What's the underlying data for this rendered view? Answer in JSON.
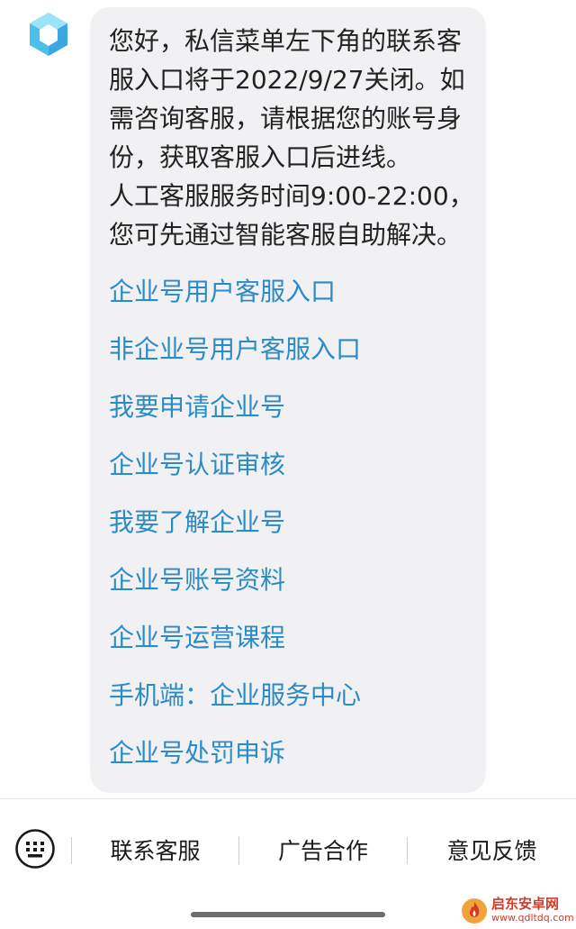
{
  "chat": {
    "message_lines": [
      "您好，私信菜单左下角的联系客",
      "服入口将于2022/9/27关闭。如",
      "需咨询客服，请根据您的账号身",
      "份，获取客服入口后进线。",
      "人工客服服务时间9:00-22:00，",
      "您可先通过智能客服自助解决。"
    ],
    "links": [
      "企业号用户客服入口",
      "非企业号用户客服入口",
      "我要申请企业号",
      "企业号认证审核",
      "我要了解企业号",
      "企业号账号资料",
      "企业号运营课程",
      "手机端：企业服务中心",
      "企业号处罚申诉"
    ]
  },
  "bottom_menu": {
    "items": [
      "联系客服",
      "广告合作",
      "意见反馈"
    ]
  },
  "watermark": {
    "title": "启东安卓网",
    "url": "www.qdltdq.com"
  },
  "colors": {
    "link": "#2b8bc5",
    "bubble_bg": "#f1f1f3",
    "text": "#222222",
    "avatar_light": "#6fd3f2",
    "avatar_dark": "#3ba7e0",
    "watermark": "#d23a2a"
  },
  "icons": {
    "avatar": "cube-logo-icon",
    "keyboard": "keyboard-icon",
    "watermark": "fire-logo-icon"
  }
}
